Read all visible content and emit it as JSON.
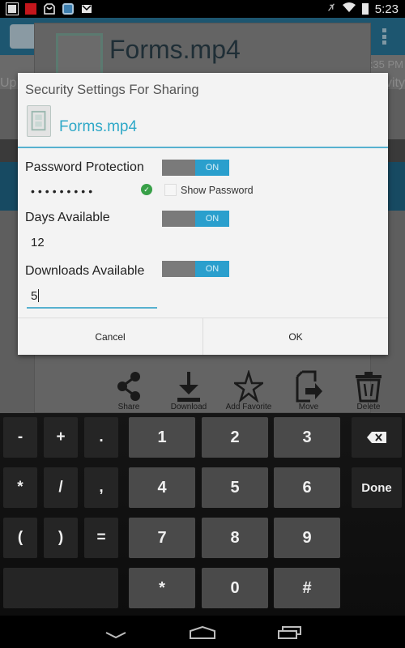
{
  "status_bar": {
    "left_icons": [
      "gallery-notification-icon",
      "cnn-notification-icon",
      "mailbox-notification-icon",
      "app-notification-icon",
      "gmail-notification-icon"
    ],
    "right_icons": [
      "mute-icon",
      "wifi-icon",
      "battery-icon"
    ],
    "time": "5:23"
  },
  "background_app": {
    "header_filename": "Forms.mp4",
    "subheader_left": "Up",
    "subheader_right": "vity",
    "timestamp": ":35 PM",
    "actions": [
      {
        "label": "Share",
        "icon": "share-icon"
      },
      {
        "label": "Download",
        "icon": "download-icon"
      },
      {
        "label": "Add Favorite",
        "icon": "star-icon"
      },
      {
        "label": "Move",
        "icon": "move-icon"
      },
      {
        "label": "Delete",
        "icon": "trash-icon"
      }
    ]
  },
  "dialog": {
    "title": "Security Settings For Sharing",
    "filename": "Forms.mp4",
    "accent_color": "#2fa8c8",
    "password": {
      "label": "Password Protection",
      "toggle": "ON",
      "value_masked": "•••••••••",
      "valid": true,
      "show_password_label": "Show Password",
      "show_password_checked": false
    },
    "days": {
      "label": "Days Available",
      "toggle": "ON",
      "value": "12"
    },
    "downloads": {
      "label": "Downloads Available",
      "toggle": "ON",
      "value": "5"
    },
    "cancel_label": "Cancel",
    "ok_label": "OK"
  },
  "keyboard": {
    "rows": [
      [
        "-",
        "+",
        ".",
        "1",
        "2",
        "3",
        "⌫"
      ],
      [
        "*",
        "/",
        ",",
        "4",
        "5",
        "6",
        "Done"
      ],
      [
        "(",
        ")",
        "=",
        "7",
        "8",
        "9"
      ],
      [
        "",
        "*",
        "0",
        "#"
      ]
    ],
    "sym_keys": [
      "-",
      "+",
      ".",
      "*",
      "/",
      ",",
      "(",
      ")",
      "="
    ],
    "num_keys": [
      "1",
      "2",
      "3",
      "4",
      "5",
      "6",
      "7",
      "8",
      "9",
      "*",
      "0",
      "#"
    ],
    "done_label": "Done"
  },
  "nav_bar": {
    "buttons": [
      "back-down-icon",
      "home-icon",
      "recents-icon"
    ]
  }
}
